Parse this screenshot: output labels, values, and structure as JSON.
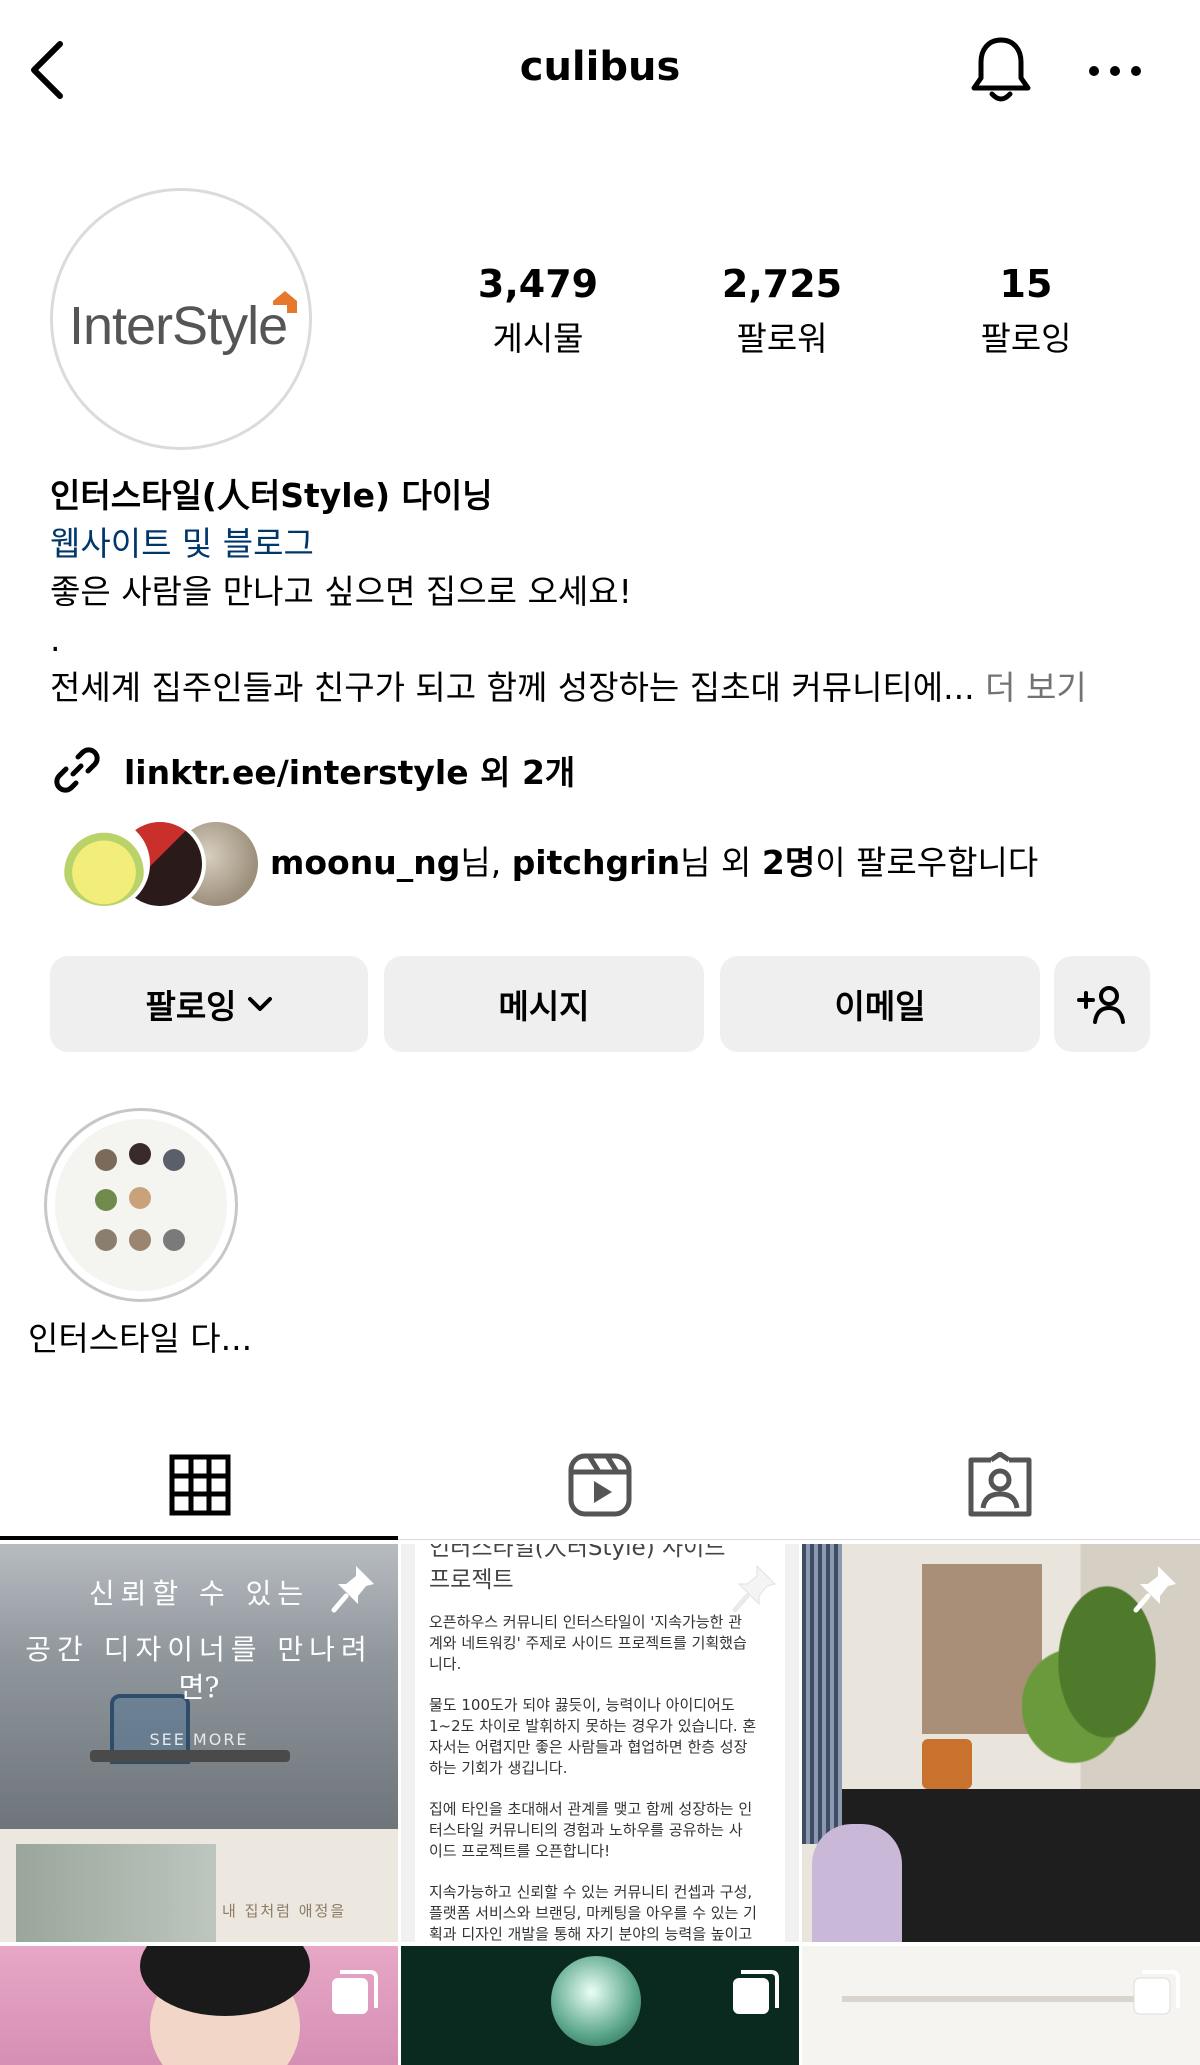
{
  "header": {
    "username": "culibus",
    "back_icon": "chevron-left-icon",
    "notifications_icon": "bell-icon",
    "more_icon": "more-horizontal-icon"
  },
  "profile": {
    "avatar_logo_text": "InterStyle",
    "stats": [
      {
        "value": "3,479",
        "label": "게시물"
      },
      {
        "value": "2,725",
        "label": "팔로워"
      },
      {
        "value": "15",
        "label": "팔로잉"
      }
    ],
    "name": "인터스타일(人터Style) 다이닝",
    "category": "웹사이트 및 블로그",
    "bio_line1": "좋은 사람을 만나고 싶으면 집으로 오세요!",
    "bio_line2": ".",
    "bio_line3": "전세계 집주인들과 친구가 되고 함께 성장하는 집초대 커뮤니티에...",
    "bio_more": "더 보기",
    "link": "linktr.ee/interstyle 외 2개",
    "followed_by": {
      "user1": "moonu_ng",
      "suffix1": "님, ",
      "user2": "pitchgrin",
      "suffix2": "님 외 ",
      "count": "2명",
      "suffix3": "이 팔로우합니다"
    }
  },
  "actions": {
    "following_label": "팔로잉",
    "message_label": "메시지",
    "email_label": "이메일",
    "add_person_icon": "add-person-icon"
  },
  "highlights": [
    {
      "label": "인터스타일 다..."
    }
  ],
  "tabs": [
    {
      "icon": "grid-icon",
      "active": true
    },
    {
      "icon": "reels-icon",
      "active": false
    },
    {
      "icon": "tagged-icon",
      "active": false
    }
  ],
  "grid": {
    "post1": {
      "line1": "신뢰할 수 있는",
      "line2": "공간 디자이너를 만나려",
      "line3": "면?",
      "see_more": "SEE MORE",
      "caption": "내 집처럼 애정을",
      "pinned": true
    },
    "post2": {
      "heading1": "인터스타일(人터Style) 사이드",
      "heading2": "프로젝트",
      "p1a": "오픈하우스 커뮤니티 인터스타일이 '지속가능한 관",
      "p1b": "계와 네트워킹' 주제로 사이드 프로젝트를 기획했습",
      "p1c": "니다.",
      "p2a": "물도 100도가 되야 끓듯이, 능력이나 아이디어도",
      "p2b": "1~2도 차이로 발휘하지 못하는 경우가 있습니다. 혼",
      "p2c": "자서는 어렵지만 좋은 사람들과 협업하면 한층 성장",
      "p2d": "하는 기회가 생깁니다.",
      "p3a": "집에 타인을 초대해서 관계를 맺고 함께 성장하는 인",
      "p3b": "터스타일 커뮤니티의 경험과 노하우를 공유하는 사",
      "p3c": "이드 프로젝트를 오픈합니다!",
      "p4a": "지속가능하고 신뢰할 수 있는 커뮤니티 컨셉과 구성,",
      "p4b": "플랫폼 서비스와 브랜딩, 마케팅을 아우를 수 있는 기",
      "p4c": "획과 디자인 개발을 통해 자기 분야의 능력을 높이고",
      "pinned": true
    },
    "post3": {
      "pinned": true
    }
  },
  "colors": {
    "link_blue": "#00376b",
    "button_bg": "#efefef",
    "muted_text": "#737373",
    "brand_orange": "#e8772e"
  }
}
